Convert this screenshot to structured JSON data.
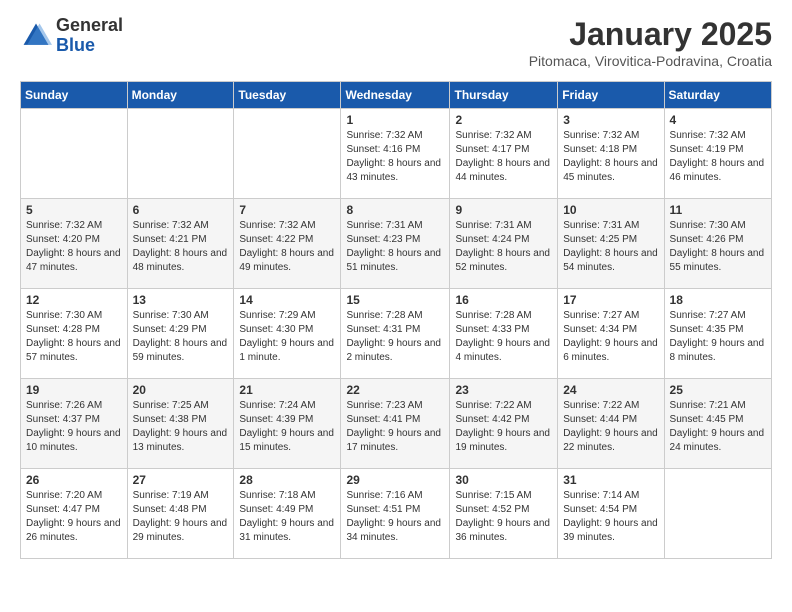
{
  "header": {
    "logo_general": "General",
    "logo_blue": "Blue",
    "month_title": "January 2025",
    "subtitle": "Pitomaca, Virovitica-Podravina, Croatia"
  },
  "weekdays": [
    "Sunday",
    "Monday",
    "Tuesday",
    "Wednesday",
    "Thursday",
    "Friday",
    "Saturday"
  ],
  "weeks": [
    [
      null,
      null,
      null,
      {
        "day": 1,
        "sunrise": "7:32 AM",
        "sunset": "4:16 PM",
        "daylight": "8 hours and 43 minutes."
      },
      {
        "day": 2,
        "sunrise": "7:32 AM",
        "sunset": "4:17 PM",
        "daylight": "8 hours and 44 minutes."
      },
      {
        "day": 3,
        "sunrise": "7:32 AM",
        "sunset": "4:18 PM",
        "daylight": "8 hours and 45 minutes."
      },
      {
        "day": 4,
        "sunrise": "7:32 AM",
        "sunset": "4:19 PM",
        "daylight": "8 hours and 46 minutes."
      }
    ],
    [
      {
        "day": 5,
        "sunrise": "7:32 AM",
        "sunset": "4:20 PM",
        "daylight": "8 hours and 47 minutes."
      },
      {
        "day": 6,
        "sunrise": "7:32 AM",
        "sunset": "4:21 PM",
        "daylight": "8 hours and 48 minutes."
      },
      {
        "day": 7,
        "sunrise": "7:32 AM",
        "sunset": "4:22 PM",
        "daylight": "8 hours and 49 minutes."
      },
      {
        "day": 8,
        "sunrise": "7:31 AM",
        "sunset": "4:23 PM",
        "daylight": "8 hours and 51 minutes."
      },
      {
        "day": 9,
        "sunrise": "7:31 AM",
        "sunset": "4:24 PM",
        "daylight": "8 hours and 52 minutes."
      },
      {
        "day": 10,
        "sunrise": "7:31 AM",
        "sunset": "4:25 PM",
        "daylight": "8 hours and 54 minutes."
      },
      {
        "day": 11,
        "sunrise": "7:30 AM",
        "sunset": "4:26 PM",
        "daylight": "8 hours and 55 minutes."
      }
    ],
    [
      {
        "day": 12,
        "sunrise": "7:30 AM",
        "sunset": "4:28 PM",
        "daylight": "8 hours and 57 minutes."
      },
      {
        "day": 13,
        "sunrise": "7:30 AM",
        "sunset": "4:29 PM",
        "daylight": "8 hours and 59 minutes."
      },
      {
        "day": 14,
        "sunrise": "7:29 AM",
        "sunset": "4:30 PM",
        "daylight": "9 hours and 1 minute."
      },
      {
        "day": 15,
        "sunrise": "7:28 AM",
        "sunset": "4:31 PM",
        "daylight": "9 hours and 2 minutes."
      },
      {
        "day": 16,
        "sunrise": "7:28 AM",
        "sunset": "4:33 PM",
        "daylight": "9 hours and 4 minutes."
      },
      {
        "day": 17,
        "sunrise": "7:27 AM",
        "sunset": "4:34 PM",
        "daylight": "9 hours and 6 minutes."
      },
      {
        "day": 18,
        "sunrise": "7:27 AM",
        "sunset": "4:35 PM",
        "daylight": "9 hours and 8 minutes."
      }
    ],
    [
      {
        "day": 19,
        "sunrise": "7:26 AM",
        "sunset": "4:37 PM",
        "daylight": "9 hours and 10 minutes."
      },
      {
        "day": 20,
        "sunrise": "7:25 AM",
        "sunset": "4:38 PM",
        "daylight": "9 hours and 13 minutes."
      },
      {
        "day": 21,
        "sunrise": "7:24 AM",
        "sunset": "4:39 PM",
        "daylight": "9 hours and 15 minutes."
      },
      {
        "day": 22,
        "sunrise": "7:23 AM",
        "sunset": "4:41 PM",
        "daylight": "9 hours and 17 minutes."
      },
      {
        "day": 23,
        "sunrise": "7:22 AM",
        "sunset": "4:42 PM",
        "daylight": "9 hours and 19 minutes."
      },
      {
        "day": 24,
        "sunrise": "7:22 AM",
        "sunset": "4:44 PM",
        "daylight": "9 hours and 22 minutes."
      },
      {
        "day": 25,
        "sunrise": "7:21 AM",
        "sunset": "4:45 PM",
        "daylight": "9 hours and 24 minutes."
      }
    ],
    [
      {
        "day": 26,
        "sunrise": "7:20 AM",
        "sunset": "4:47 PM",
        "daylight": "9 hours and 26 minutes."
      },
      {
        "day": 27,
        "sunrise": "7:19 AM",
        "sunset": "4:48 PM",
        "daylight": "9 hours and 29 minutes."
      },
      {
        "day": 28,
        "sunrise": "7:18 AM",
        "sunset": "4:49 PM",
        "daylight": "9 hours and 31 minutes."
      },
      {
        "day": 29,
        "sunrise": "7:16 AM",
        "sunset": "4:51 PM",
        "daylight": "9 hours and 34 minutes."
      },
      {
        "day": 30,
        "sunrise": "7:15 AM",
        "sunset": "4:52 PM",
        "daylight": "9 hours and 36 minutes."
      },
      {
        "day": 31,
        "sunrise": "7:14 AM",
        "sunset": "4:54 PM",
        "daylight": "9 hours and 39 minutes."
      },
      null
    ]
  ]
}
